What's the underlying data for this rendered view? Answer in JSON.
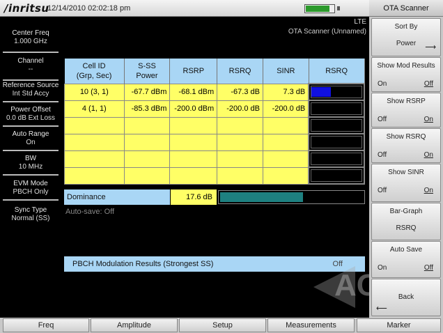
{
  "header": {
    "logo": "/inritsu",
    "datetime": "12/14/2010 02:02:18 pm",
    "battery_level": 0.82
  },
  "left_panel": [
    {
      "label": "Center Freq",
      "value": "1.000 GHz"
    },
    {
      "label": "Channel",
      "value": "--"
    },
    {
      "label": "Reference Source",
      "value": "Int Std Accy"
    },
    {
      "label": "Power Offset",
      "value": "0.0 dB Ext Loss"
    },
    {
      "label": "Auto Range",
      "value": "On"
    },
    {
      "label": "BW",
      "value": "10 MHz"
    },
    {
      "label": "EVM Mode",
      "value": "PBCH Only"
    },
    {
      "label": "Sync Type",
      "value": "Normal (SS)"
    }
  ],
  "mode": {
    "standard": "LTE",
    "subtitle": "OTA Scanner (Unnamed)"
  },
  "table": {
    "headers": [
      [
        "Cell ID",
        "(Grp, Sec)"
      ],
      [
        "S-SS",
        "Power"
      ],
      [
        "RSRP",
        ""
      ],
      [
        "RSRQ",
        ""
      ],
      [
        "SINR",
        ""
      ],
      [
        "RSRQ",
        ""
      ]
    ],
    "rows": [
      {
        "cell": "10 (3, 1)",
        "power": "-67.7 dBm",
        "rsrp": "-68.1 dBm",
        "rsrq": "-67.3 dB",
        "sinr": "7.3 dB",
        "bar": 0.38
      },
      {
        "cell": "4 (1, 1)",
        "power": "-85.3 dBm",
        "rsrp": "-200.0 dBm",
        "rsrq": "-200.0 dB",
        "sinr": "-200.0 dB",
        "bar": 0
      },
      {
        "cell": "",
        "power": "",
        "rsrp": "",
        "rsrq": "",
        "sinr": "",
        "bar": 0
      },
      {
        "cell": "",
        "power": "",
        "rsrp": "",
        "rsrq": "",
        "sinr": "",
        "bar": 0
      },
      {
        "cell": "",
        "power": "",
        "rsrp": "",
        "rsrq": "",
        "sinr": "",
        "bar": 0
      },
      {
        "cell": "",
        "power": "",
        "rsrp": "",
        "rsrq": "",
        "sinr": "",
        "bar": 0
      }
    ]
  },
  "dominance": {
    "label": "Dominance",
    "value": "17.6 dB",
    "level": 0.57
  },
  "autosave": "Auto-save: Off",
  "pbch": {
    "label": "PBCH Modulation Results (Strongest SS)",
    "state": "Off"
  },
  "watermark": "ACT",
  "softkeys": {
    "title": "OTA Scanner",
    "sort_by": {
      "title": "Sort By",
      "value": "Power"
    },
    "show_mod": {
      "title": "Show Mod Results",
      "on": "On",
      "off": "Off"
    },
    "show_rsrp": {
      "title": "Show RSRP",
      "off": "Off",
      "on": "On"
    },
    "show_rsrq": {
      "title": "Show RSRQ",
      "off": "Off",
      "on": "On"
    },
    "show_sinr": {
      "title": "Show SINR",
      "off": "Off",
      "on": "On"
    },
    "bar_graph": {
      "title": "Bar-Graph",
      "value": "RSRQ"
    },
    "auto_save": {
      "title": "Auto Save",
      "on": "On",
      "off": "Off"
    },
    "back": {
      "title": "Back"
    }
  },
  "bottom_menu": [
    "Freq",
    "Amplitude",
    "Setup",
    "Measurements",
    "Marker"
  ]
}
